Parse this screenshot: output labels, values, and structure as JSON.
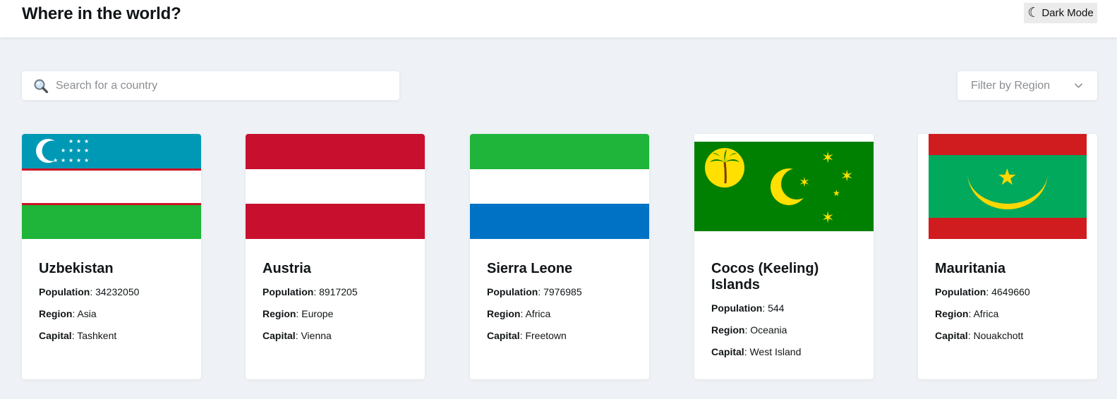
{
  "header": {
    "title": "Where in the world?",
    "dark_mode_label": "Dark Mode",
    "dark_mode_icon": "moon-icon"
  },
  "search": {
    "placeholder": "Search for a country",
    "value": "",
    "icon": "search-icon"
  },
  "filter": {
    "label": "Filter by Region",
    "icon": "chevron-down-icon"
  },
  "labels": {
    "population": "Population",
    "region": "Region",
    "capital": "Capital",
    "separator": ":"
  },
  "countries": [
    {
      "name": "Uzbekistan",
      "population": "34232050",
      "region": "Asia",
      "capital": "Tashkent",
      "flag": "flag-uzbekistan"
    },
    {
      "name": "Austria",
      "population": "8917205",
      "region": "Europe",
      "capital": "Vienna",
      "flag": "flag-austria"
    },
    {
      "name": "Sierra Leone",
      "population": "7976985",
      "region": "Africa",
      "capital": "Freetown",
      "flag": "flag-sierra-leone"
    },
    {
      "name": "Cocos (Keeling) Islands",
      "population": "544",
      "region": "Oceania",
      "capital": "West Island",
      "flag": "flag-cocos-keeling-islands"
    },
    {
      "name": "Mauritania",
      "population": "4649660",
      "region": "Africa",
      "capital": "Nouakchott",
      "flag": "flag-mauritania"
    }
  ],
  "colors": {
    "page_background": "#eef1f6",
    "card_background": "#ffffff",
    "text": "#111517",
    "placeholder": "#8a8d91"
  }
}
